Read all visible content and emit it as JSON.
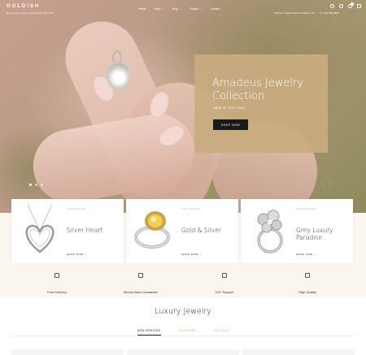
{
  "header": {
    "logo": "GOLDISH",
    "promo": "Best summer offer is sale limited, $100 OFF",
    "nav": [
      {
        "label": "Home",
        "has_caret": false
      },
      {
        "label": "Shop",
        "has_caret": true
      },
      {
        "label": "Blog",
        "has_caret": true
      },
      {
        "label": "Pages",
        "has_caret": true
      },
      {
        "label": "Contact",
        "has_caret": false
      }
    ],
    "address": "986 St. Classic Street, Southern, NY",
    "phone": "+123 456 6890"
  },
  "hero": {
    "title": "Amadeus Jewelry Collection",
    "subtitle": "NEW IN 2024 SALE",
    "button": "SHOP NOW",
    "slides": 3,
    "active_slide": 1,
    "prev": "‹",
    "next": "›"
  },
  "categories": [
    {
      "tag": "COLLECTION",
      "title": "Silver Heart",
      "link": "SHOP NOW →"
    },
    {
      "tag": "COLLECTION",
      "title": "Gold & Silver",
      "link": "SHOP NOW →"
    },
    {
      "tag": "COLLECTION",
      "title": "Grey Luxury Paradise",
      "link": "SHOP NOW →"
    }
  ],
  "features": [
    {
      "label": "Free Delivery",
      "icon": "truck-icon"
    },
    {
      "label": "Money Back Guarantee",
      "icon": "money-icon"
    },
    {
      "label": "24/7 Support",
      "icon": "support-icon"
    },
    {
      "label": "High Quality",
      "icon": "quality-icon"
    }
  ],
  "section": {
    "title": "Luxury Jewelry",
    "tabs": [
      "NEW ARRIVED",
      "FEATURED",
      "ON SALE"
    ],
    "active_tab": 0
  },
  "colors": {
    "accent": "#c9ab80",
    "dark": "#1a1a1a",
    "beige": "#faf5ed"
  }
}
